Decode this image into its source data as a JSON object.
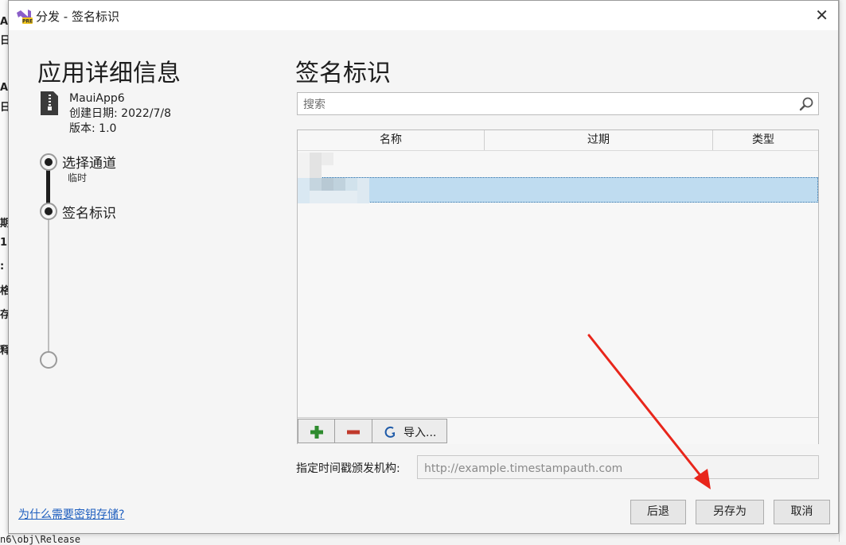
{
  "window": {
    "title": "分发 - 签名标识",
    "close_glyph": "✕"
  },
  "left_panel": {
    "heading": "应用详细信息",
    "app_name": "MauiApp6",
    "created": "创建日期: 2022/7/8",
    "version": "版本: 1.0",
    "steps": [
      {
        "label": "选择通道",
        "sub": "临时",
        "state": "completed"
      },
      {
        "label": "签名标识",
        "sub": "",
        "state": "current"
      },
      {
        "label": "",
        "sub": "",
        "state": "pending"
      }
    ],
    "help_link": "为什么需要密钥存储?"
  },
  "main": {
    "heading": "签名标识",
    "search_placeholder": "搜索",
    "table": {
      "columns": [
        "名称",
        "过期",
        "类型"
      ],
      "rows": [
        {
          "name": "",
          "expires": "",
          "type": "",
          "selected": true
        }
      ]
    },
    "toolbar": {
      "add_icon": "plus-icon",
      "remove_icon": "minus-icon",
      "import_label": "导入..."
    },
    "timestamp": {
      "label": "指定时间戳颁发机构:",
      "placeholder": "http://example.timestampauth.com"
    }
  },
  "footer": {
    "back": "后退",
    "save_as": "另存为",
    "cancel": "取消"
  },
  "background": {
    "left_glyphs": [
      "A",
      "日",
      "A",
      "日",
      "期",
      "1",
      ":",
      "格",
      "存",
      "释"
    ],
    "bottom_text": "n6\\obj\\Release"
  },
  "colors": {
    "accent_selected": "#bfdcf0",
    "link": "#1f5fbf",
    "add_green": "#2e8b2e",
    "remove_red": "#c0392b",
    "arrow_red": "#e8261b"
  }
}
